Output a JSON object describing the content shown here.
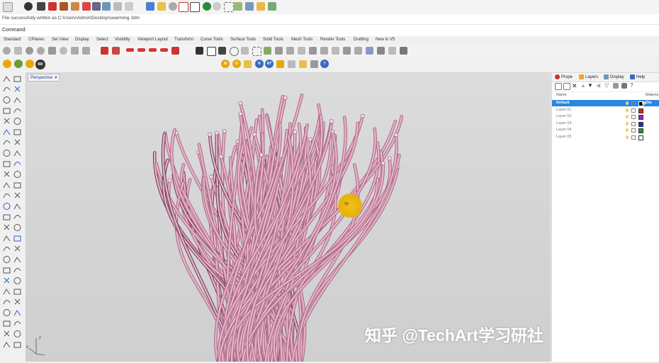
{
  "command": {
    "history": "File successfully written as C:\\Users\\Admin\\Desktop\\swarming 3dm",
    "prompt_label": "Command:"
  },
  "tabs": [
    "Standard",
    "CPlanes",
    "Set View",
    "Display",
    "Select",
    "Visibility",
    "Viewport Layout",
    "Transform",
    "Curve Tools",
    "Surface Tools",
    "Solid Tools",
    "Mesh Tools",
    "Render Tools",
    "Drafting",
    "New in V5"
  ],
  "viewport": {
    "title": "Perspective",
    "axis_x": "x",
    "axis_z": "z",
    "cursor_badge": "ls"
  },
  "watermark": "知乎 @TechArt学习研社",
  "panel": {
    "tabs": [
      "Prope",
      "Layers",
      "Display",
      "Help"
    ],
    "header_name": "Name",
    "header_material": "Materia",
    "layers": [
      {
        "name": "Default",
        "color": "#000000",
        "selected": true,
        "material": "Dia"
      },
      {
        "name": "Layer 01",
        "color": "#e02020"
      },
      {
        "name": "Layer 02",
        "color": "#a020c0"
      },
      {
        "name": "Layer 03",
        "color": "#2030c8"
      },
      {
        "name": "Layer 04",
        "color": "#18a030"
      },
      {
        "name": "Layer 05",
        "color": "#ffffff"
      }
    ]
  },
  "osnap_icons": [
    "M",
    "D",
    "R",
    "D",
    "R"
  ],
  "colors": {
    "accent": "#2a86e0",
    "fiber": "#e9b2c8",
    "highlight": "#f5c20b"
  }
}
